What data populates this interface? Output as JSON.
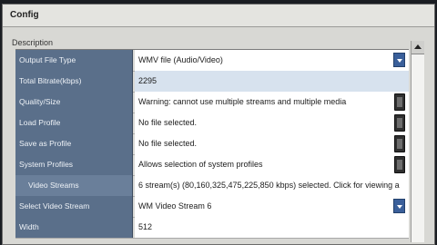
{
  "window": {
    "title": "Config"
  },
  "section": {
    "label": "Description"
  },
  "rows": [
    {
      "label": "Output File Type",
      "value": "WMV file (Audio/Video)"
    },
    {
      "label": "Total Bitrate(kbps)",
      "value": "2295"
    },
    {
      "label": "Quality/Size",
      "value": "Warning: cannot use multiple streams and multiple media"
    },
    {
      "label": "Load Profile",
      "value": "No file selected."
    },
    {
      "label": "Save as Profile",
      "value": "No file selected."
    },
    {
      "label": "System Profiles",
      "value": "Allows selection of system profiles"
    },
    {
      "label": "Video Streams",
      "value": "6 stream(s) (80,160,325,475,225,850 kbps) selected. Click for viewing a"
    },
    {
      "label": "Select Video Stream",
      "value": "WM Video Stream 6"
    },
    {
      "label": "Width",
      "value": "512"
    }
  ],
  "icons": {
    "dropdown": "chevron-down-icon",
    "ellipsis": "ellipsis-icon",
    "scroll_up": "arrow-up-icon"
  },
  "colors": {
    "label_bg": "#5a6f8a",
    "dropdown_button": "#3a5f9a",
    "highlight_row": "#d7e2ee"
  }
}
